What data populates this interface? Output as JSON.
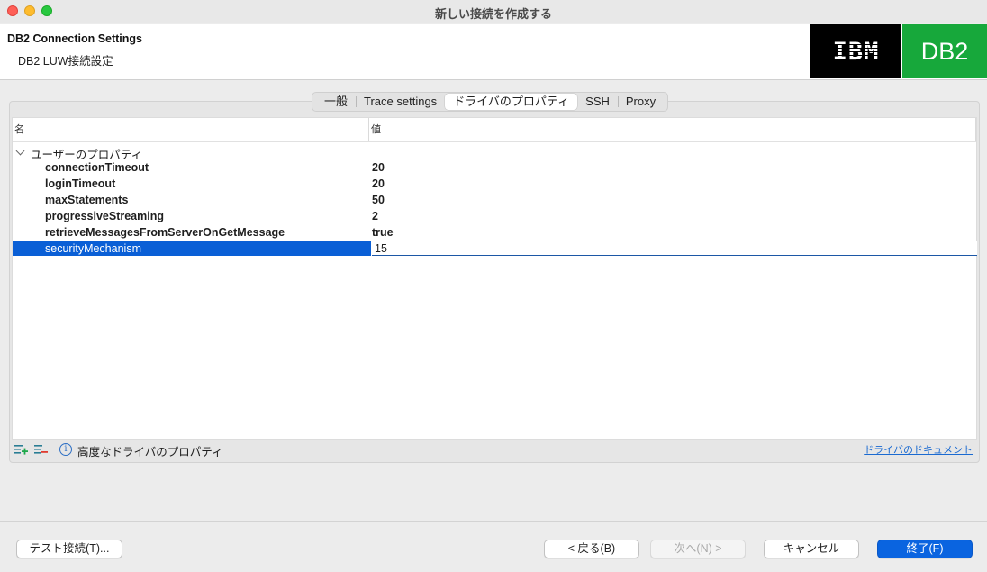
{
  "window": {
    "title": "新しい接続を作成する"
  },
  "header": {
    "title": "DB2 Connection Settings",
    "subtitle": "DB2 LUW接続設定",
    "logo_ibm": "IBM",
    "logo_db2": "DB2",
    "colors": {
      "ibm_bg": "#000000",
      "db2_bg": "#17a83b"
    }
  },
  "tabs": [
    {
      "label": "一般",
      "active": false
    },
    {
      "label": "Trace settings",
      "active": false
    },
    {
      "label": "ドライバのプロパティ",
      "active": true
    },
    {
      "label": "SSH",
      "active": false
    },
    {
      "label": "Proxy",
      "active": false
    }
  ],
  "table": {
    "columns": {
      "name": "名",
      "value": "値"
    },
    "group": {
      "label": "ユーザーのプロパティ",
      "expanded": true
    },
    "rows": [
      {
        "name": "connectionTimeout",
        "value": "20"
      },
      {
        "name": "loginTimeout",
        "value": "20"
      },
      {
        "name": "maxStatements",
        "value": "50"
      },
      {
        "name": "progressiveStreaming",
        "value": "2"
      },
      {
        "name": "retrieveMessagesFromServerOnGetMessage",
        "value": "true"
      },
      {
        "name": "securityMechanism",
        "value": "15",
        "selected": true
      }
    ]
  },
  "toolbar": {
    "add_icon": "add-property-icon",
    "remove_icon": "remove-property-icon",
    "info_icon": "info-icon",
    "advanced_label": "高度なドライバのプロパティ",
    "doc_link": "ドライバのドキュメント"
  },
  "buttons": {
    "test": "テスト接続(T)...",
    "back": "< 戻る(B)",
    "next": "次へ(N) >",
    "cancel": "キャンセル",
    "finish": "終了(F)"
  },
  "colors": {
    "accent": "#0a64e0",
    "selection": "#0a5fd6",
    "link": "#1a6ad1"
  }
}
